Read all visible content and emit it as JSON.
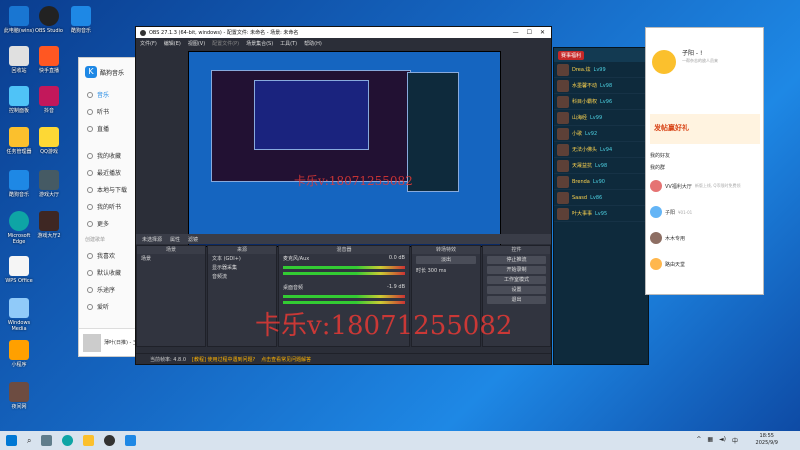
{
  "desktop": {
    "icons_col1": [
      "此电脑(wins)",
      "回收站",
      "控制面板",
      "任务管理器",
      "酷狗音乐",
      "Microsoft Edge",
      "WPS Office",
      "Windows Media",
      "小程序",
      "夜间网"
    ],
    "icons_col2": [
      "OBS Studio",
      "快手直播",
      "抖音",
      "QQ游戏",
      "游戏大厅",
      "游戏大厅2"
    ],
    "icons_col3": [
      "酷狗音乐"
    ]
  },
  "music_app": {
    "brand": "酷狗音乐",
    "nav": [
      "音乐",
      "听书",
      "直播"
    ],
    "my": [
      "我的收藏",
      "最近播放",
      "本地与下载",
      "我的听书",
      "更多"
    ],
    "section_label": "创建歌单",
    "playlists": [
      "我喜欢",
      "默认收藏",
      "乐途序",
      "爱听"
    ],
    "player_text": "薄叶(日推) - 王"
  },
  "obs": {
    "title": "OBS 27.1.3 (64-bit, windows) - 配置文件: 未命名 - 场景: 未命名",
    "menu": [
      "文件(F)",
      "编辑(E)",
      "视图(V)",
      "配置文件(P)",
      "场景集合(S)",
      "工具(T)",
      "帮助(H)"
    ],
    "toolbar_label": "未选择源",
    "toolbar_items": [
      "属性",
      "滤镜"
    ],
    "panels": {
      "scenes": {
        "title": "场景",
        "items": [
          "场景"
        ]
      },
      "sources": {
        "title": "来源",
        "items": [
          "文本 (GDI+)",
          "显示器采集",
          "音频流"
        ]
      },
      "mixer": {
        "title": "混音器",
        "tracks": [
          "麦克风/Aux",
          "桌面音频"
        ],
        "levels": [
          "0.0 dB",
          "-1.9 dB"
        ]
      },
      "transitions": {
        "title": "转场特效",
        "type": "淡出",
        "duration_label": "时长",
        "duration": "300 ms"
      },
      "controls": {
        "title": "控件",
        "buttons": [
          "停止推流",
          "开始录制",
          "工作室模式",
          "设置",
          "退出"
        ]
      }
    },
    "status": {
      "fps": "当前帧率: 4.8.0",
      "tip": "[教程] 使用过程中遇到问题?",
      "link": "点击查看常见问题解答"
    }
  },
  "game_panel": {
    "tag": "赛事福利",
    "rows": [
      {
        "name": "Drea.炫",
        "level": "Lv99"
      },
      {
        "name": "水墨馨不动",
        "level": "Lv98"
      },
      {
        "name": "科目小霸权",
        "level": "Lv96"
      },
      {
        "name": "山海经",
        "level": "Lv99"
      },
      {
        "name": "小歌",
        "level": "Lv92"
      },
      {
        "name": "无法小佛头",
        "level": "Lv94"
      },
      {
        "name": "天晟益抗",
        "level": "Lv98"
      },
      {
        "name": "Brenda",
        "level": "Lv90"
      },
      {
        "name": "Saasd",
        "level": "Lv86"
      },
      {
        "name": "叶大事事",
        "level": "Lv95"
      }
    ]
  },
  "chat_app": {
    "title": "子阳 - !",
    "subtitle": "一帮杂志的放人员来",
    "banner": "发帖赢好礼",
    "rows": [
      {
        "name": "我的好友",
        "sub": ""
      },
      {
        "name": "我的群",
        "sub": ""
      },
      {
        "name": "VV福利大厅",
        "sub": "新版上线, Q币限时免费领"
      },
      {
        "name": "子阳",
        "sub": "¥01-01"
      },
      {
        "name": "木木专用",
        "sub": ""
      },
      {
        "name": "路由天堂",
        "sub": ""
      }
    ]
  },
  "watermark": {
    "large": "卡乐v:18071255082",
    "small": "卡乐v:18071255082"
  },
  "taskbar": {
    "time": "18:55",
    "date": "2025/9/9"
  },
  "colors": {
    "obs_bg": "#2b2e38",
    "accent": "#1e88e5",
    "watermark": "#e53935",
    "game_gold": "#ffd54f"
  }
}
